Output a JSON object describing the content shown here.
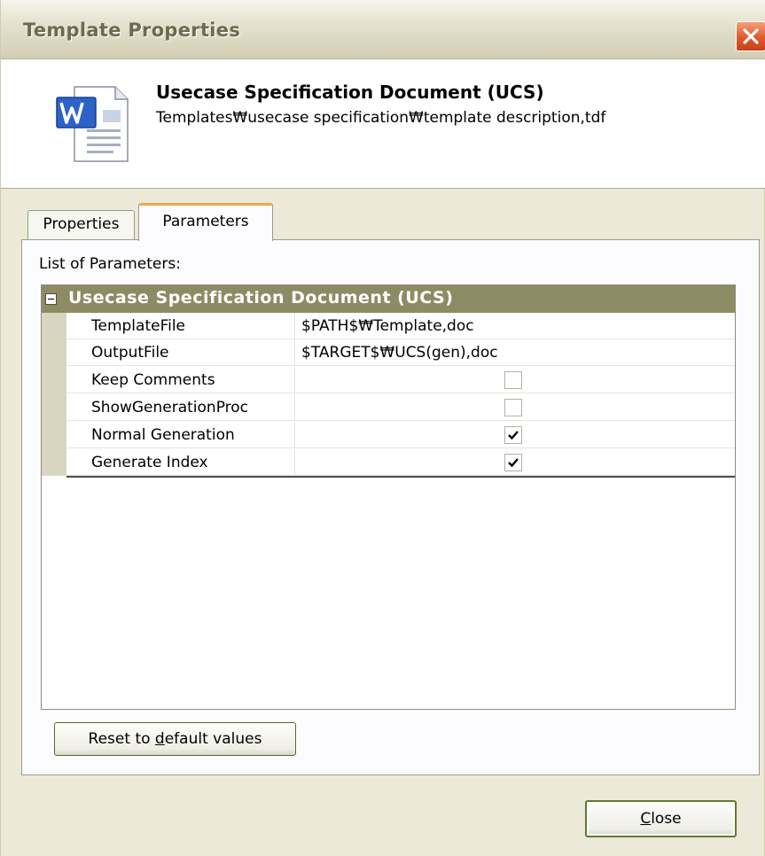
{
  "window": {
    "title": "Template Properties"
  },
  "header": {
    "template_name": "Usecase Specification Document (UCS)",
    "template_path": "Templates₩usecase specification₩template description,tdf",
    "icon": "word-document-icon"
  },
  "tabs": [
    {
      "label": "Properties",
      "selected": false
    },
    {
      "label": "Parameters",
      "selected": true
    }
  ],
  "parameters": {
    "list_label": "List of Parameters:",
    "group_label": "Usecase Specification Document (UCS)",
    "group_expanded": true,
    "rows": [
      {
        "name": "TemplateFile",
        "value": "$PATH$₩Template,doc",
        "type": "text"
      },
      {
        "name": "OutputFile",
        "value": "$TARGET$₩UCS(gen),doc",
        "type": "text"
      },
      {
        "name": "Keep Comments",
        "checked": false,
        "type": "checkbox"
      },
      {
        "name": "ShowGenerationProc",
        "checked": false,
        "type": "checkbox"
      },
      {
        "name": "Normal Generation",
        "checked": true,
        "type": "checkbox"
      },
      {
        "name": "Generate Index",
        "checked": true,
        "type": "checkbox"
      }
    ]
  },
  "buttons": {
    "reset_prefix": "Reset to ",
    "reset_mnemonic": "d",
    "reset_suffix": "efault values",
    "close_mnemonic": "C",
    "close_suffix": "lose"
  },
  "colors": {
    "group_header_bg": "#8d8b63",
    "active_tab_accent": "#f4a646",
    "close_button_red": "#de5a2e",
    "dialog_bg": "#ece9d8"
  }
}
